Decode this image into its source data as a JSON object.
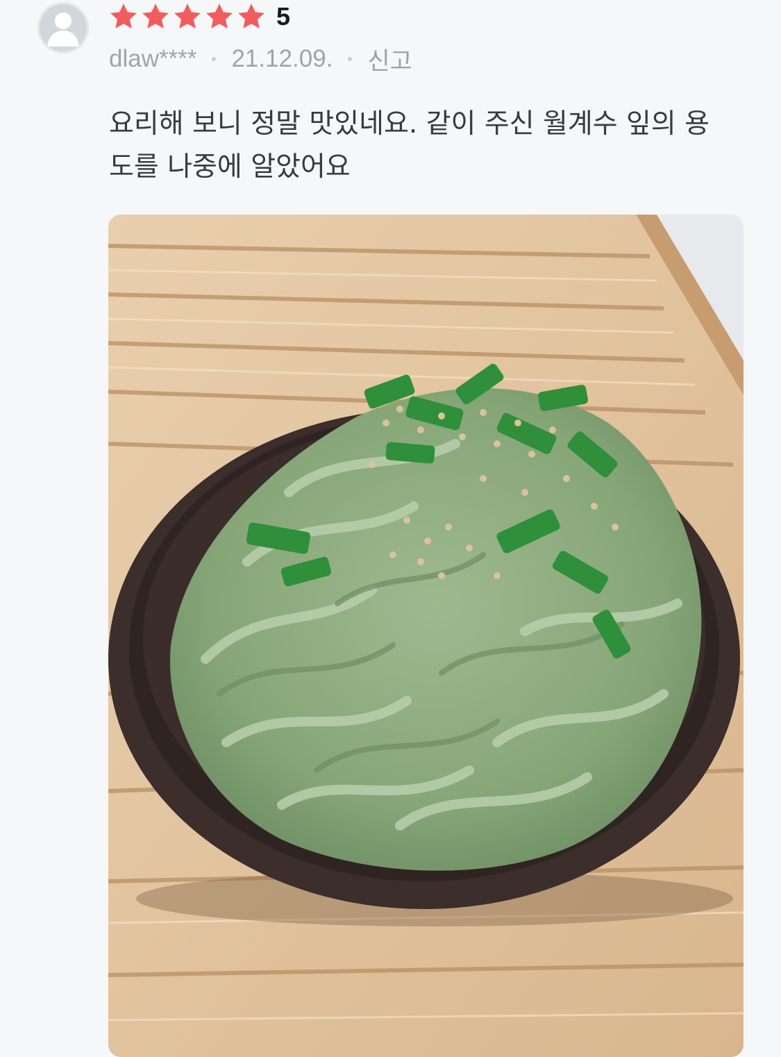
{
  "review": {
    "avatar_icon": "default-user-avatar-icon",
    "rating": {
      "stars": 5,
      "max": 5,
      "value_label": "5",
      "star_color": "#f25c5c",
      "star_icon": "star-icon"
    },
    "author": "dlaw****",
    "date": "21.12.09.",
    "report_label": "신고",
    "body": "요리해 보니 정말 맛있네요. 같이 주신 월계수 잎의 용도를 나중에 알았어요",
    "photo_icon": "food-photo"
  }
}
